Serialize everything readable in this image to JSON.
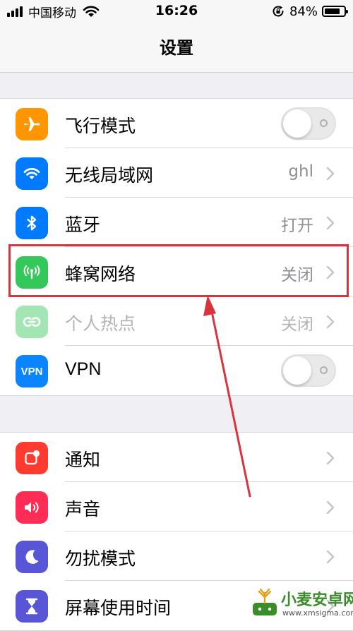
{
  "status_bar": {
    "carrier": "中国移动",
    "time": "16:26",
    "battery_percent": "84%",
    "battery_level": 0.84,
    "icons": [
      "signal-icon",
      "wifi-icon",
      "rotation-lock-icon",
      "battery-icon"
    ]
  },
  "nav": {
    "title": "设置"
  },
  "groups": [
    {
      "rows": [
        {
          "label": "飞行模式",
          "icon": "airplane-icon",
          "icon_color": "#ff9500",
          "control": "toggle",
          "toggle_on": false
        },
        {
          "label": "无线局域网",
          "icon": "wifi-icon",
          "icon_color": "#007aff",
          "value": "ghl",
          "control": "chevron"
        },
        {
          "label": "蓝牙",
          "icon": "bluetooth-icon",
          "icon_color": "#007aff",
          "value": "打开",
          "control": "chevron"
        },
        {
          "label": "蜂窝网络",
          "icon": "cellular-antenna-icon",
          "icon_color": "#34c759",
          "value": "关闭",
          "control": "chevron",
          "highlighted": true
        },
        {
          "label": "个人热点",
          "icon": "personal-hotspot-icon",
          "icon_color": "#34c759",
          "value": "关闭",
          "control": "chevron",
          "disabled": true
        },
        {
          "label": "VPN",
          "icon": "vpn-icon",
          "icon_color": "#0a84ff",
          "icon_text": "VPN",
          "control": "toggle",
          "toggle_on": false
        }
      ]
    },
    {
      "rows": [
        {
          "label": "通知",
          "icon": "notifications-icon",
          "icon_color": "#ff3b30",
          "control": "chevron"
        },
        {
          "label": "声音",
          "icon": "sound-speaker-icon",
          "icon_color": "#ff2d55",
          "control": "chevron"
        },
        {
          "label": "勿扰模式",
          "icon": "moon-icon",
          "icon_color": "#5856d6",
          "control": "chevron"
        },
        {
          "label": "屏幕使用时间",
          "icon": "hourglass-icon",
          "icon_color": "#5856d6",
          "control": "chevron"
        }
      ]
    }
  ],
  "annotation": {
    "highlight_color": "#d9343e",
    "arrow_color": "#d9343e"
  },
  "watermark": {
    "name": "小麦安卓网",
    "url": "www.xmsigma.com"
  }
}
